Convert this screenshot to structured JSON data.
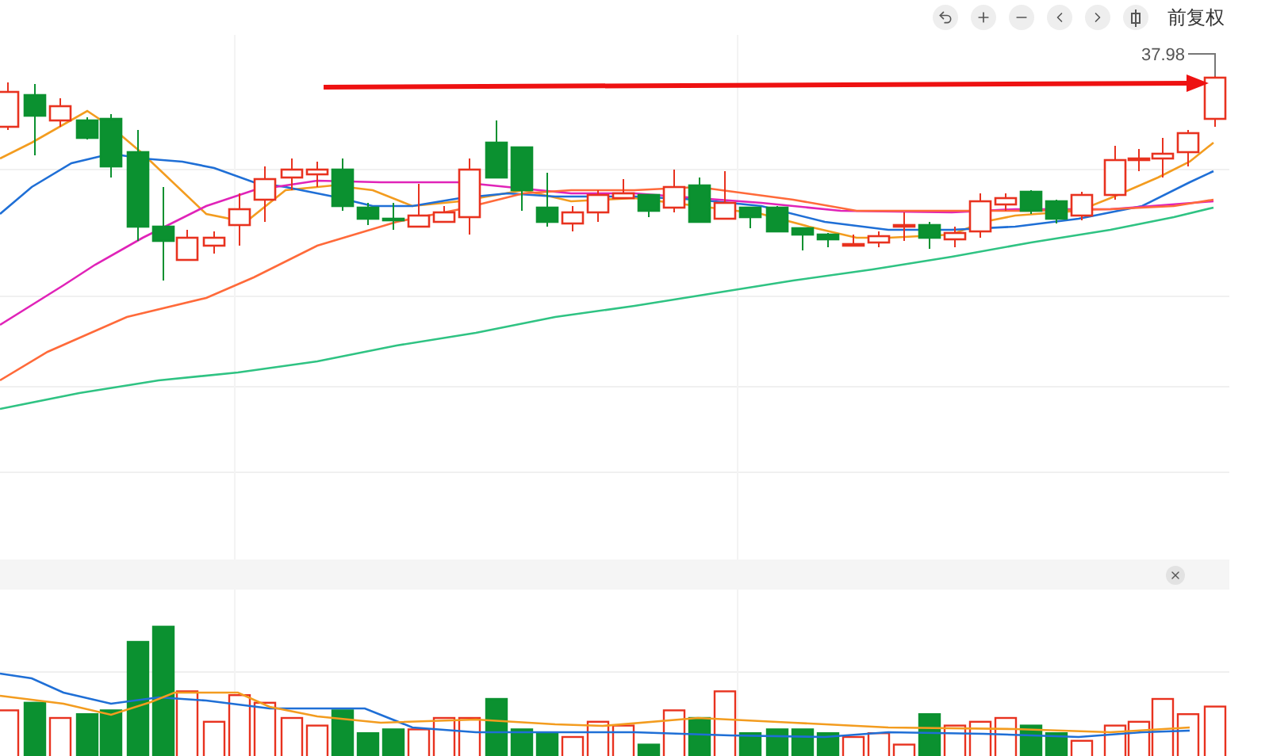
{
  "toolbar": {
    "adjust_label": "前复权"
  },
  "price_chart": {
    "last_price": "37.98"
  }
}
